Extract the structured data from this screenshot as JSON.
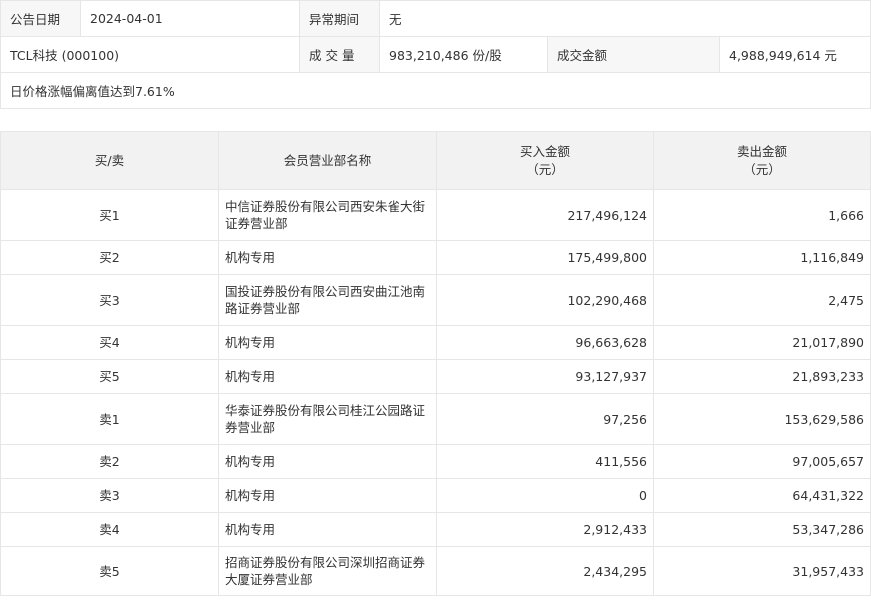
{
  "info": {
    "date_label": "公告日期",
    "date_value": "2024-04-01",
    "period_label": "异常期间",
    "period_value": "无",
    "stock": "TCL科技 (000100)",
    "volume_label": "成 交 量",
    "volume_value": "983,210,486 份/股",
    "amount_label": "成交金额",
    "amount_value": "4,988,949,614 元",
    "reason": "日价格涨幅偏离值达到7.61%"
  },
  "seats": {
    "headers": {
      "side": "买/卖",
      "name": "会员营业部名称",
      "buy_line1": "买入金额",
      "buy_line2": "（元）",
      "sell_line1": "卖出金额",
      "sell_line2": "（元）"
    },
    "rows": [
      {
        "side": "买1",
        "name": "中信证券股份有限公司西安朱雀大街证券营业部",
        "buy": "217,496,124",
        "sell": "1,666"
      },
      {
        "side": "买2",
        "name": "机构专用",
        "buy": "175,499,800",
        "sell": "1,116,849"
      },
      {
        "side": "买3",
        "name": "国投证券股份有限公司西安曲江池南路证券营业部",
        "buy": "102,290,468",
        "sell": "2,475"
      },
      {
        "side": "买4",
        "name": "机构专用",
        "buy": "96,663,628",
        "sell": "21,017,890"
      },
      {
        "side": "买5",
        "name": "机构专用",
        "buy": "93,127,937",
        "sell": "21,893,233"
      },
      {
        "side": "卖1",
        "name": "华泰证券股份有限公司桂江公园路证券营业部",
        "buy": "97,256",
        "sell": "153,629,586"
      },
      {
        "side": "卖2",
        "name": "机构专用",
        "buy": "411,556",
        "sell": "97,005,657"
      },
      {
        "side": "卖3",
        "name": "机构专用",
        "buy": "0",
        "sell": "64,431,322"
      },
      {
        "side": "卖4",
        "name": "机构专用",
        "buy": "2,912,433",
        "sell": "53,347,286"
      },
      {
        "side": "卖5",
        "name": "招商证券股份有限公司深圳招商证券大厦证券营业部",
        "buy": "2,434,295",
        "sell": "31,957,433"
      }
    ]
  }
}
